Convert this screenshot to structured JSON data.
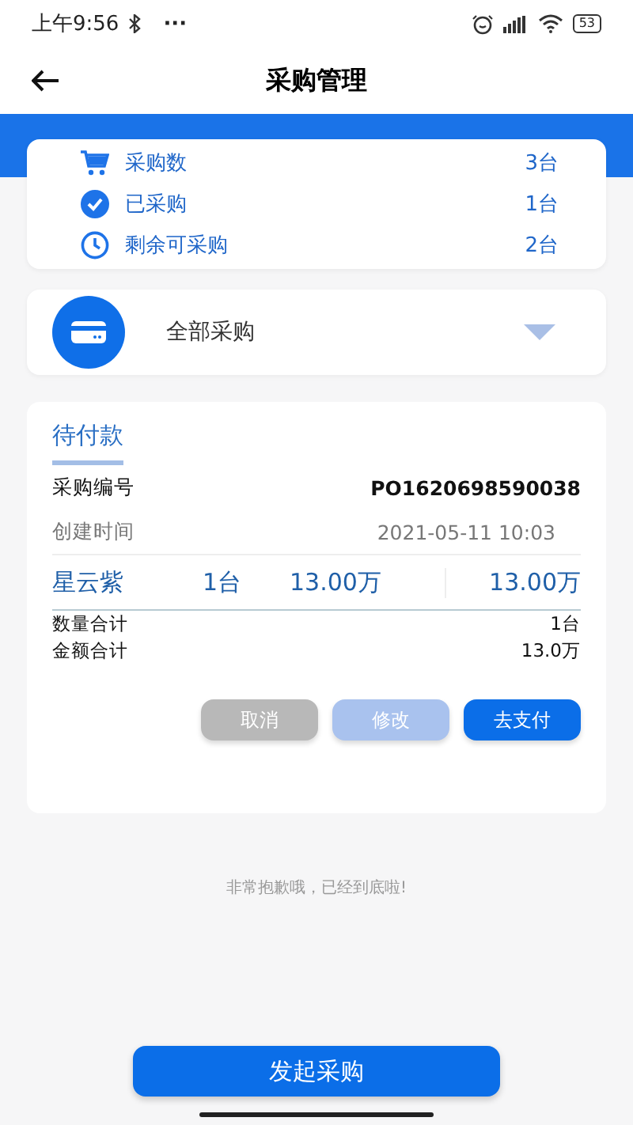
{
  "status_bar": {
    "time": "上午9:56",
    "dots": "···",
    "battery": "53"
  },
  "header": {
    "title": "采购管理"
  },
  "stats": [
    {
      "label": "采购数",
      "value": "3台"
    },
    {
      "label": "已采购",
      "value": "1台"
    },
    {
      "label": "剩余可采购",
      "value": "2台"
    }
  ],
  "filter": {
    "value": "全部采购"
  },
  "order": {
    "tab": "待付款",
    "fields": [
      {
        "label": "采购编号",
        "value": "PO1620698590038",
        "kind": "strong"
      },
      {
        "label": "创建时间",
        "value": "2021-05-11 10:03",
        "kind": "muted"
      }
    ],
    "item": {
      "name": "星云紫",
      "quantity": "1台",
      "price": "13.00万",
      "total": "13.00万"
    },
    "totals": [
      {
        "label": "数量合计",
        "value": "1台"
      },
      {
        "label": "金额合计",
        "value": "13.0万"
      }
    ],
    "buttons": [
      {
        "label": "取消",
        "kind": "grey",
        "disabled": true
      },
      {
        "label": "修改",
        "kind": "blue",
        "disabled": true
      },
      {
        "label": "去支付",
        "kind": "blue",
        "disabled": false
      }
    ]
  },
  "end_note": "非常抱歉哦，已经到底啦!",
  "primary_button": "发起采购"
}
